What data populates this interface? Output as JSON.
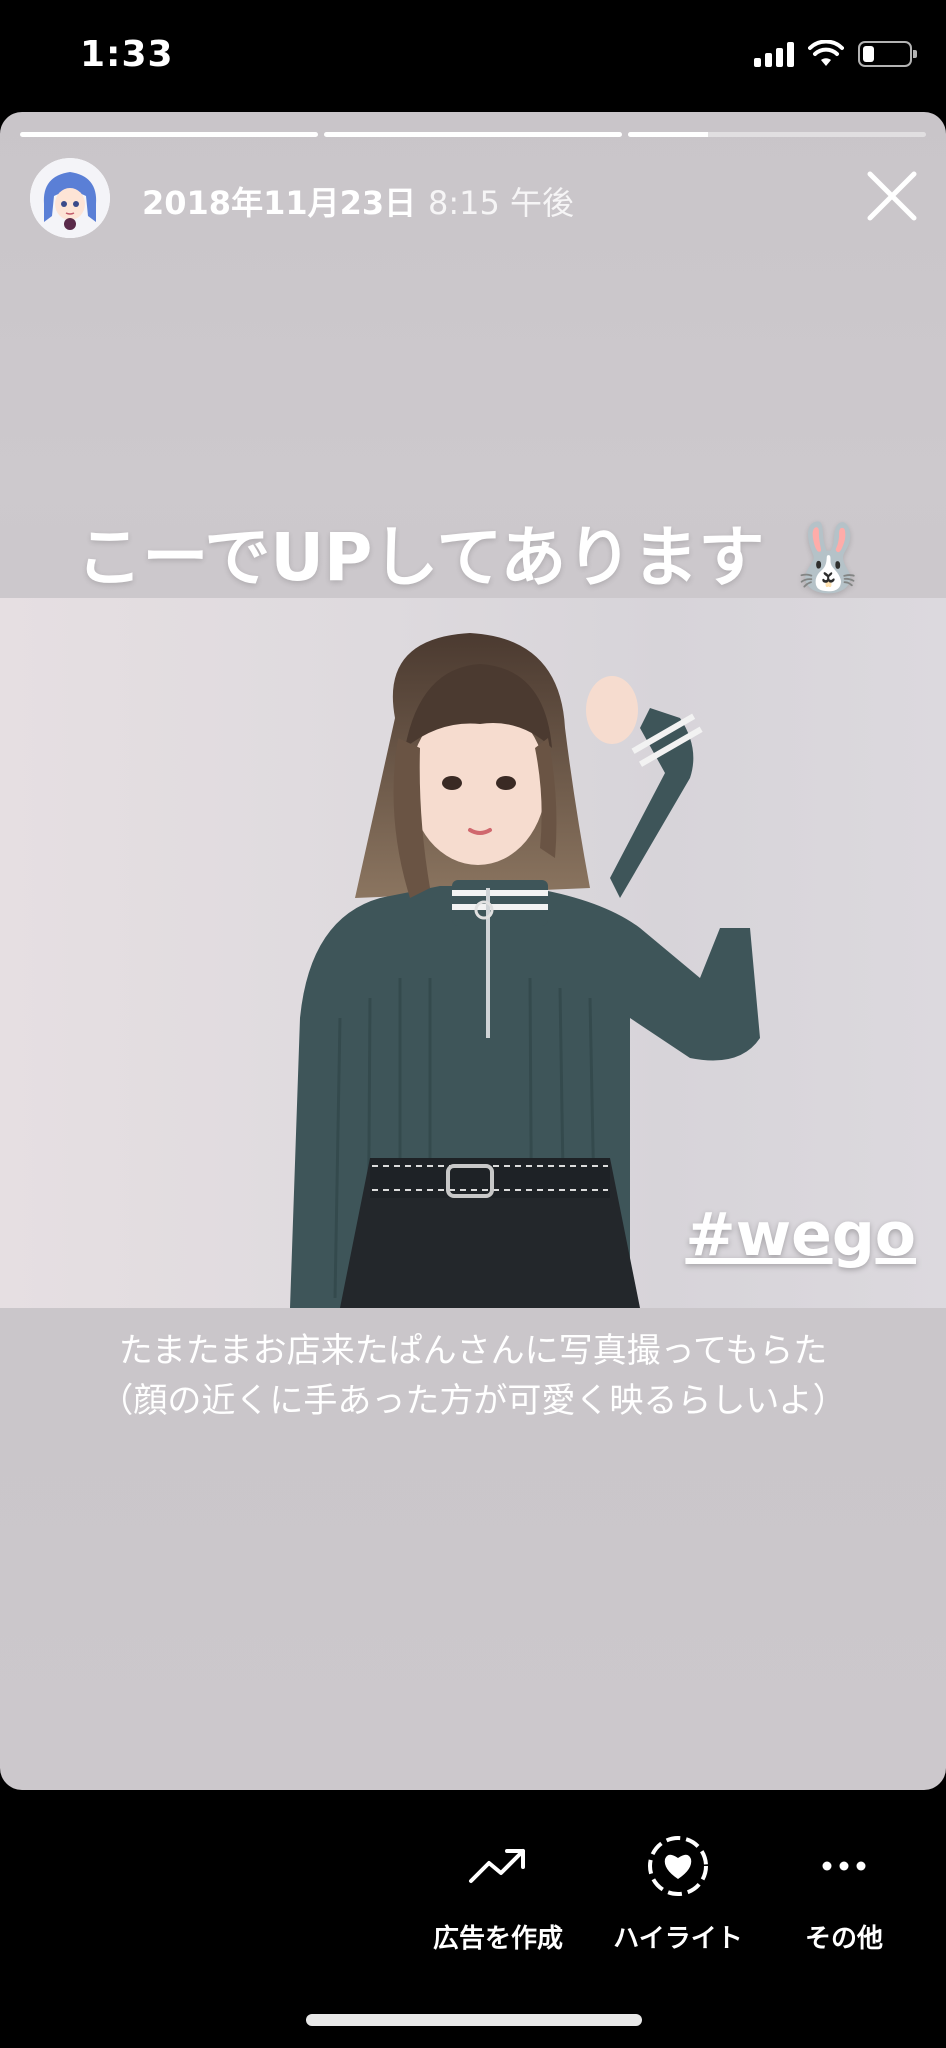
{
  "status": {
    "time": "1:33",
    "battery_level": 0.25
  },
  "story": {
    "progress": [
      1.0,
      1.0,
      0.27
    ],
    "date": "2018年11月23日",
    "time": "8:15 午後",
    "headline": "こーでUPしてあります 🐰",
    "hashtag": "#wego",
    "caption": {
      "line1": "たまたまお店来たぱんさんに写真撮ってもらた",
      "line2": "（顔の近くに手あった方が可愛く映るらしいよ）"
    }
  },
  "actions": {
    "ads_label": "広告を作成",
    "highlight_label": "ハイライト",
    "more_label": "その他"
  },
  "icons": [
    "signal-icon",
    "wifi-icon",
    "battery-icon",
    "close-icon",
    "trending-up-icon",
    "highlight-heart-icon",
    "more-dots-icon"
  ]
}
